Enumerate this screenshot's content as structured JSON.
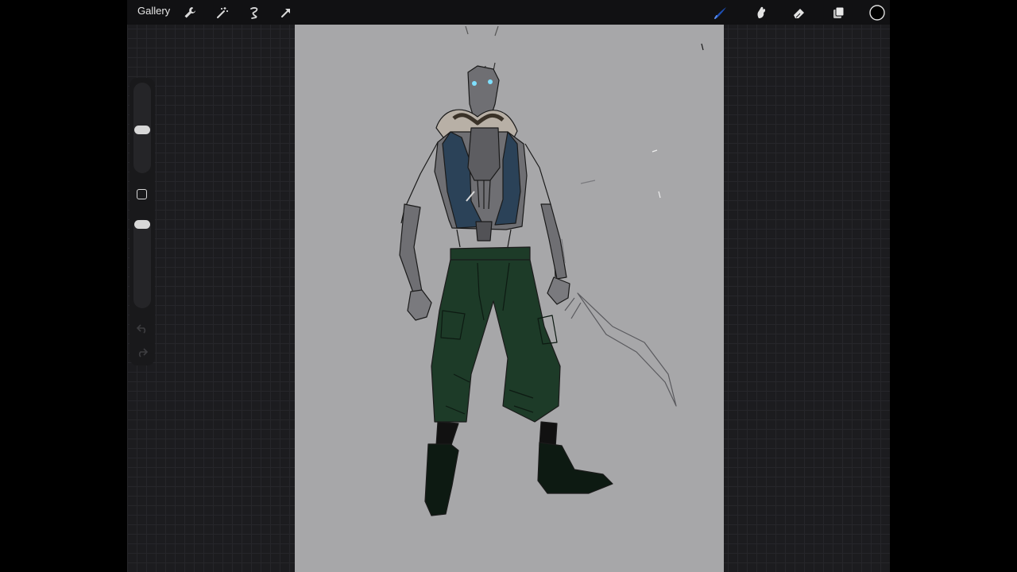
{
  "topbar": {
    "gallery_label": "Gallery",
    "left_icons": [
      "wrench-icon",
      "magic-wand-icon",
      "selection-icon",
      "transform-arrow-icon"
    ],
    "right_icons": [
      "brush-icon",
      "smudge-icon",
      "eraser-icon",
      "layers-icon",
      "color-swatch-icon"
    ],
    "active_tool": "brush",
    "active_color": "#1d4fb5",
    "current_color": "#000000"
  },
  "sidebar": {
    "brush_size_level": 0.48,
    "opacity_level": 1.0,
    "controls": [
      "brush-size-slider",
      "modify-button",
      "opacity-slider",
      "undo-icon",
      "redo-icon"
    ]
  },
  "canvas": {
    "background_color": "#a7a7a9",
    "palette": {
      "pants": "#1d3b28",
      "vest": "#2b4258",
      "body": "#6f6f73",
      "boots": "#0d1a12",
      "eyes": "#7fe0ff"
    }
  }
}
